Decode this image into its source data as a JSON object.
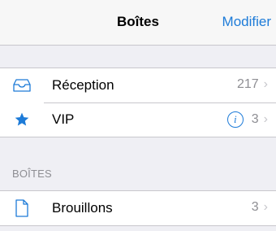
{
  "header": {
    "title": "Boîtes",
    "edit_label": "Modifier"
  },
  "mailboxes": [
    {
      "label": "Réception",
      "count": "217",
      "icon": "inbox-tray-icon"
    },
    {
      "label": "VIP",
      "count": "3",
      "icon": "star-icon",
      "has_info": true
    }
  ],
  "section": {
    "header": "BOÎTES"
  },
  "folders": [
    {
      "label": "Brouillons",
      "count": "3",
      "icon": "document-icon"
    }
  ],
  "colors": {
    "accent": "#1d7bd8",
    "background": "#efeff4",
    "secondary_text": "#8e8e93"
  }
}
